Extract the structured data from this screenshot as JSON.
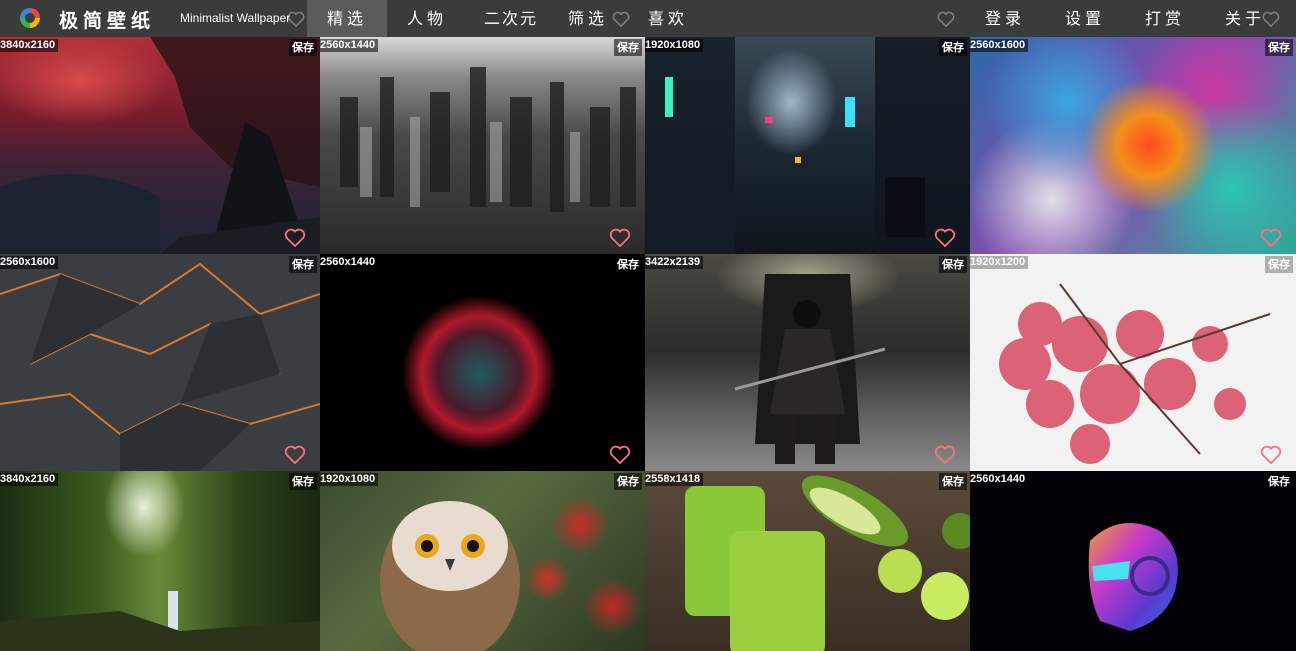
{
  "header": {
    "brand_cn": "极简壁纸",
    "brand_en": "Minimalist Wallpaper",
    "nav_left": [
      {
        "id": "featured",
        "label": "精选",
        "active": true
      },
      {
        "id": "people",
        "label": "人物",
        "active": false
      },
      {
        "id": "anime",
        "label": "二次元",
        "active": false
      },
      {
        "id": "filter",
        "label": "筛选",
        "active": false
      },
      {
        "id": "favorites",
        "label": "喜欢",
        "active": false
      }
    ],
    "nav_right": [
      {
        "id": "login",
        "label": "登录"
      },
      {
        "id": "settings",
        "label": "设置"
      },
      {
        "id": "tip",
        "label": "打赏"
      },
      {
        "id": "about",
        "label": "关于"
      }
    ]
  },
  "icons": {
    "logo": "wallpaper-logo-icon",
    "heart": "heart-outline-icon"
  },
  "colors": {
    "topbar": "#3a3c3c",
    "active_tab": "#5a5c5c",
    "heart": "#ff6f7d"
  },
  "save_label": "保存",
  "wallpapers": [
    {
      "resolution": "3840x2160",
      "subject": "dark fantasy army red sky"
    },
    {
      "resolution": "2560x1440",
      "subject": "black and white city aerial"
    },
    {
      "resolution": "1920x1080",
      "subject": "cyberpunk neon street"
    },
    {
      "resolution": "2560x1600",
      "subject": "colorful paint explosion"
    },
    {
      "resolution": "2560x1600",
      "subject": "dark geometric plates orange glow"
    },
    {
      "resolution": "2560x1440",
      "subject": "particle sphere on black"
    },
    {
      "resolution": "3422x2139",
      "subject": "knight on throne"
    },
    {
      "resolution": "1920x1200",
      "subject": "blossom branch face silhouette"
    },
    {
      "resolution": "3840x2160",
      "subject": "forest waterfall"
    },
    {
      "resolution": "1920x1080",
      "subject": "owl with red berries"
    },
    {
      "resolution": "2558x1418",
      "subject": "green smoothies and avocado"
    },
    {
      "resolution": "2560x1440",
      "subject": "neon robot head"
    }
  ]
}
